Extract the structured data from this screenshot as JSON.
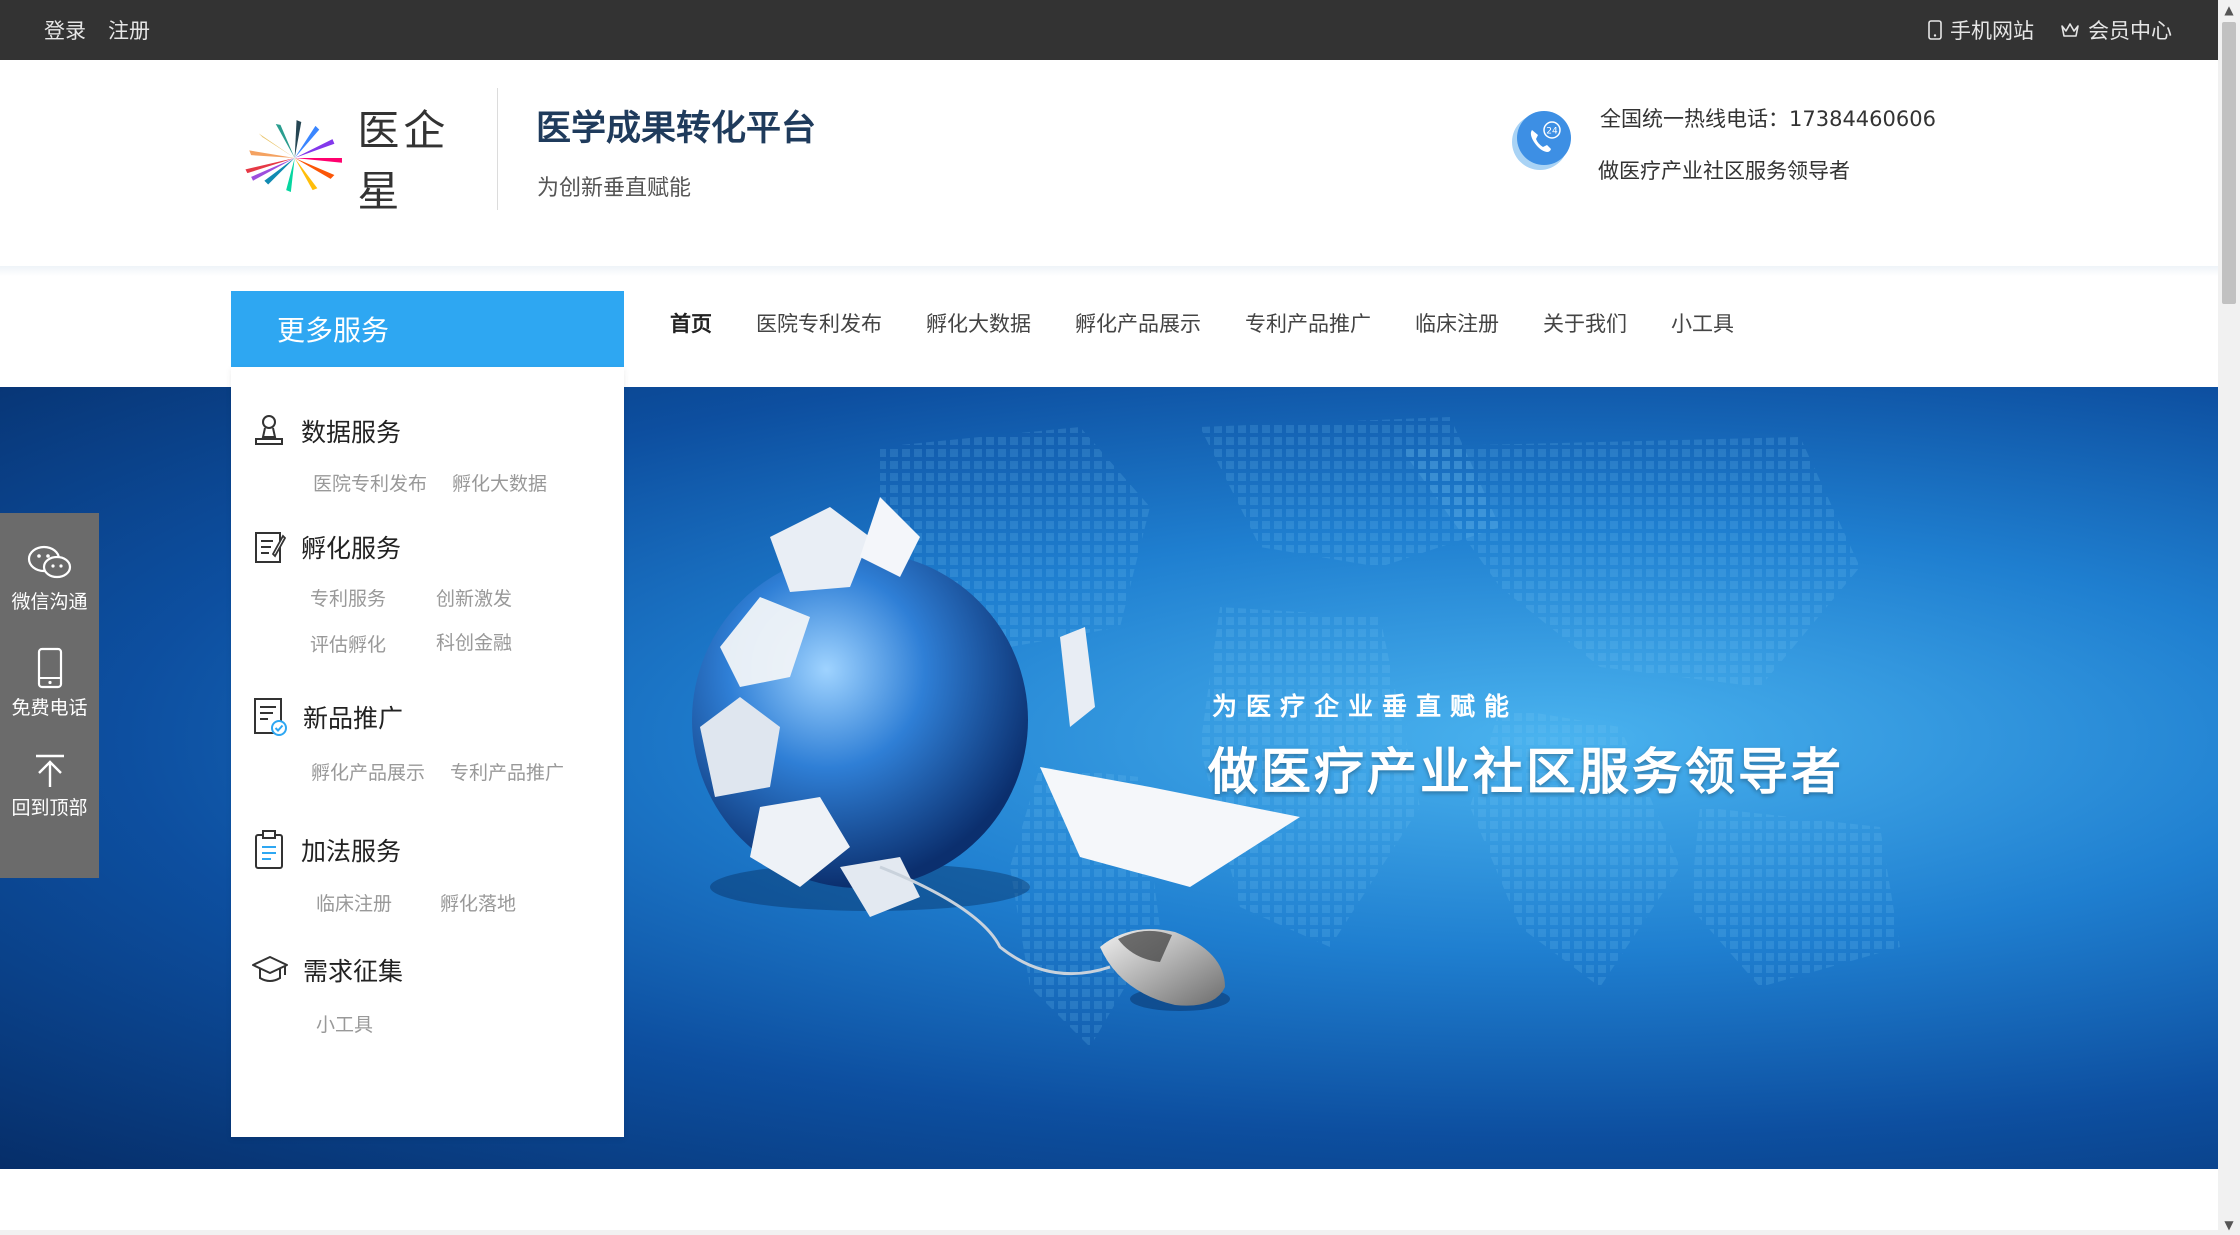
{
  "topbar": {
    "login": "登录",
    "register": "注册",
    "mobile": "手机网站",
    "member": "会员中心"
  },
  "header": {
    "logo_text": "医企星",
    "title": "医学成果转化平台",
    "subtitle": "为创新垂直赋能",
    "hotline": "全国统一热线电话：17384460606",
    "slogan": "做医疗产业社区服务领导者",
    "hotline_badge": "24"
  },
  "nav": {
    "more_services": "更多服务",
    "items": [
      "首页",
      "医院专利发布",
      "孵化大数据",
      "孵化产品展示",
      "专利产品推广",
      "临床注册",
      "关于我们",
      "小工具"
    ]
  },
  "menu": {
    "groups": [
      {
        "title": "数据服务",
        "icon": "stamp-icon",
        "items": [
          "医院专利发布",
          "孵化大数据"
        ]
      },
      {
        "title": "孵化服务",
        "icon": "notepad-icon",
        "items": [
          "专利服务",
          "创新激发",
          "评估孵化",
          "科创金融"
        ]
      },
      {
        "title": "新品推广",
        "icon": "certificate-icon",
        "items": [
          "孵化产品展示",
          "专利产品推广"
        ]
      },
      {
        "title": "加法服务",
        "icon": "clipboard-icon",
        "items": [
          "临床注册",
          "孵化落地"
        ]
      },
      {
        "title": "需求征集",
        "icon": "graduation-cap-icon",
        "items": [
          "小工具"
        ]
      }
    ]
  },
  "banner": {
    "small": "为医疗企业垂直赋能",
    "big": "做医疗产业社区服务领导者"
  },
  "side": {
    "wechat": "微信沟通",
    "phone": "免费电话",
    "top": "回到顶部"
  },
  "colors": {
    "topbar": "#333333",
    "accent": "#2ea7f2",
    "side": "#6b6b6b"
  }
}
